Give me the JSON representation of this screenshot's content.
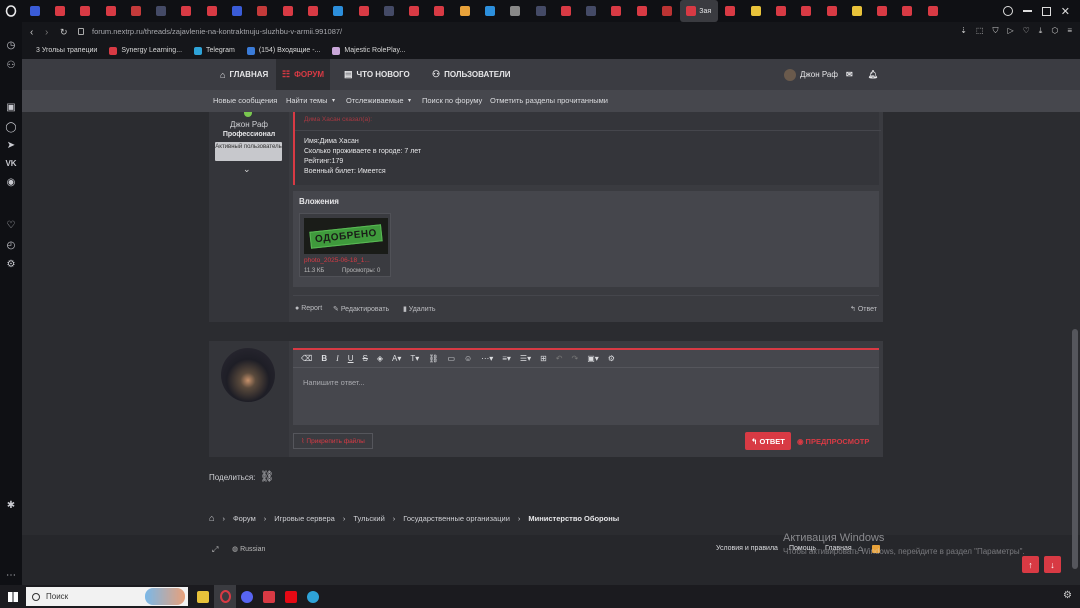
{
  "browser": {
    "url": "forum.nextrp.ru/threads/zajavlenie-na-kontraktnuju-sluzhbu-v-armii.991087/",
    "active_tab_label": "Зая",
    "tab_colors": [
      "#3a5cd8",
      "#d83a44",
      "#d83a44",
      "#d83a44",
      "#c43a3a",
      "#444a66",
      "#d83a44",
      "#d83a44",
      "#3a5cd8",
      "#c43a3a",
      "#d83a44",
      "#d83a44",
      "#2c8fdc",
      "#d83a44",
      "#444a66",
      "#d83a44",
      "#d83a44",
      "#e8a23a",
      "#2c8fdc",
      "#888888",
      "#444a66",
      "#d83a44",
      "#444a66",
      "#d83a44",
      "#d83a44",
      "#b33",
      "#d83a44",
      "#d83a44",
      "#e8c23a",
      "#d83a44",
      "#d83a44",
      "#d83a44",
      "#e8c23a",
      "#d83a44",
      "#d83a44",
      "#d83a44"
    ],
    "bookmarks": [
      {
        "label": "3 Угольы трапеции",
        "color": "#555"
      },
      {
        "label": "Synergy Learning...",
        "color": "#d83a44"
      },
      {
        "label": "Telegram",
        "color": "#2ea3d8"
      },
      {
        "label": "(154) Входящие -...",
        "color": "#3a7bd8"
      },
      {
        "label": "Majestic RolePlay...",
        "color": "#c8a6d8"
      }
    ]
  },
  "nav": {
    "home": "ГЛАВНАЯ",
    "forum": "ФОРУМ",
    "whats_new": "ЧТО НОВОГО",
    "users": "ПОЛЬЗОВАТЕЛИ",
    "username": "Джон Раф"
  },
  "subnav": {
    "new_posts": "Новые сообщения",
    "find_threads": "Найти темы",
    "watched": "Отслеживаемые",
    "search": "Поиск по форуму",
    "mark_read": "Отметить разделы прочитанными"
  },
  "post": {
    "author": "Джон Раф",
    "role": "Профессионал",
    "badge": "Активный пользователь",
    "quote_author": "Дима Хасан сказал(а):",
    "lines": [
      "Имя:Дима Хасан",
      "Сколько проживаете в городе: 7 лет",
      "Рейтинг:179",
      "Военный билет: Имеется"
    ],
    "attachments_title": "Вложения",
    "stamp_text": "ОДОБРЕНО",
    "file_name": "photo_2025-06-18_1...",
    "file_size": "11.3 КБ",
    "file_views": "Просмотры: 0",
    "report": "Report",
    "edit": "Редактировать",
    "delete": "Удалить",
    "reply": "Ответ"
  },
  "editor": {
    "placeholder": "Напишите ответ...",
    "attach": "Прикрепить файлы",
    "reply": "ОТВЕТ",
    "preview": "ПРЕДПРОСМОТР"
  },
  "share": {
    "label": "Поделиться:"
  },
  "breadcrumb": [
    "Форум",
    "Игровые сервера",
    "Тульский",
    "Государственные организации",
    "Министерство Обороны"
  ],
  "footer": {
    "language": "Russian",
    "terms": "Условия и правила",
    "help": "Помощь",
    "main": "Главная"
  },
  "watermark": {
    "title": "Активация Windows",
    "subtitle": "Чтобы активировать Windows, перейдите в раздел \"Параметры\"."
  },
  "taskbar": {
    "search": "Поиск"
  }
}
